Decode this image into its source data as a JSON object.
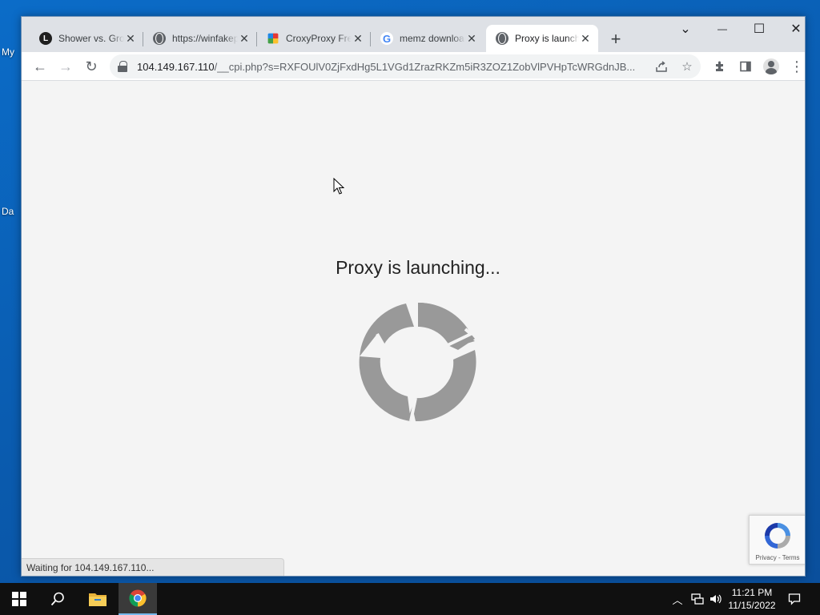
{
  "desktop": {
    "icons": [
      {
        "label": "My"
      },
      {
        "label": "Da"
      }
    ]
  },
  "browser": {
    "tabs": [
      {
        "title": "Shower vs. Growers",
        "favicon": "dark-logo-icon",
        "active": false
      },
      {
        "title": "https://winfakepc",
        "favicon": "globe-icon",
        "active": false
      },
      {
        "title": "CroxyProxy Free",
        "favicon": "croxyproxy-logo-icon",
        "active": false
      },
      {
        "title": "memz download",
        "favicon": "google-icon",
        "active": false
      },
      {
        "title": "Proxy is launching...",
        "favicon": "globe-icon",
        "active": true
      }
    ],
    "new_tab_label": "+",
    "window_controls": {
      "tab_search": "⌄",
      "minimize": "—",
      "maximize": "☐",
      "close": "✕"
    },
    "address": {
      "host": "104.149.167.110",
      "path": "/__cpi.php?s=RXFOUlV0ZjFxdHg5L1VGd1ZrazRKZm5iR3ZOZ1ZobVlPVHpTcWRGdnJB..."
    },
    "nav": {
      "back": "←",
      "forward": "→",
      "reload": "↻"
    }
  },
  "page": {
    "title": "Proxy is launching...",
    "status": "Waiting for 104.149.167.110...",
    "recaptcha": {
      "privacy": "Privacy",
      "separator": " - ",
      "terms": "Terms"
    }
  },
  "taskbar": {
    "time": "11:21 PM",
    "date": "11/15/2022"
  },
  "colors": {
    "spinner": "#999999",
    "accent": "#76b9ed"
  }
}
